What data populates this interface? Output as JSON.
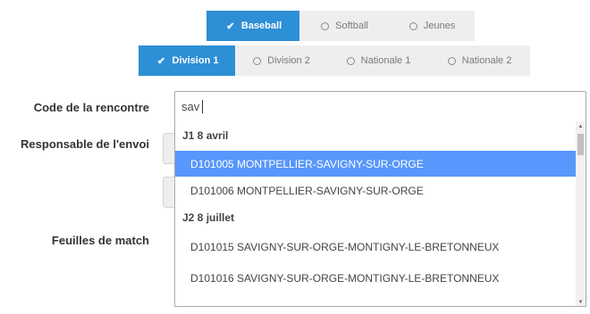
{
  "sport_tabs": [
    {
      "label": "Baseball",
      "active": true,
      "icon": "check-icon"
    },
    {
      "label": "Softball",
      "active": false,
      "icon": "radio-icon"
    },
    {
      "label": "Jeunes",
      "active": false,
      "icon": "radio-icon"
    }
  ],
  "division_tabs": [
    {
      "label": "Division 1",
      "active": true,
      "icon": "check-icon"
    },
    {
      "label": "Division 2",
      "active": false,
      "icon": "radio-icon"
    },
    {
      "label": "Nationale 1",
      "active": false,
      "icon": "radio-icon"
    },
    {
      "label": "Nationale 2",
      "active": false,
      "icon": "radio-icon"
    }
  ],
  "form": {
    "code_label": "Code de la rencontre",
    "code_value": "sav",
    "responsable_label": "Responsable de l'envoi",
    "feuilles_label": "Feuilles de match"
  },
  "dropdown": {
    "groups": [
      {
        "label": "J1 8 avril",
        "options": [
          "D101005 MONTPELLIER-SAVIGNY-SUR-ORGE",
          "D101006 MONTPELLIER-SAVIGNY-SUR-ORGE"
        ]
      },
      {
        "label": "J2 8 juillet",
        "options": [
          "D101015 SAVIGNY-SUR-ORGE-MONTIGNY-LE-BRETONNEUX",
          "D101016 SAVIGNY-SUR-ORGE-MONTIGNY-LE-BRETONNEUX"
        ]
      }
    ],
    "highlighted": "D101005 MONTPELLIER-SAVIGNY-SUR-ORGE"
  },
  "colors": {
    "accent": "#2d8fd5",
    "highlight": "#5897fb",
    "inactive_bg": "#eeeeee"
  }
}
